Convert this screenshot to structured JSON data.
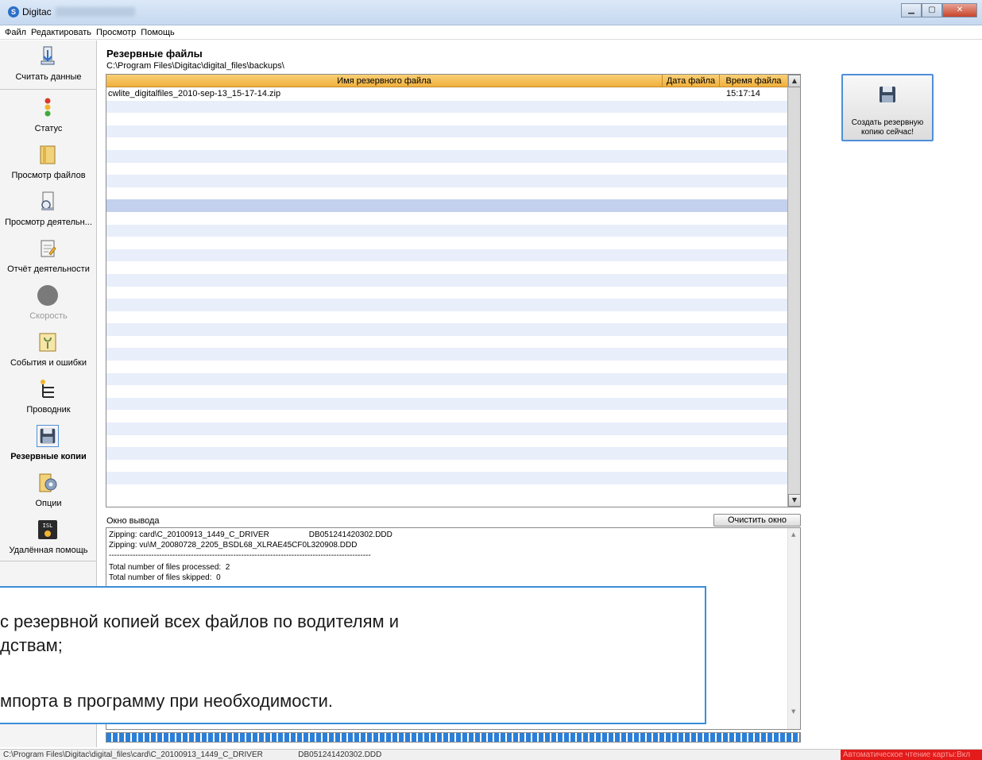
{
  "window": {
    "title": "Digitac",
    "app_icon": "S"
  },
  "menu": [
    "Файл",
    "Редактировать",
    "Просмотр",
    "Помощь"
  ],
  "sidebar": {
    "items": [
      {
        "id": "read-data",
        "label": "Считать данные",
        "icon": "download-icon",
        "disabled": false,
        "active": false
      },
      {
        "id": "status",
        "label": "Статус",
        "icon": "traffic-light-icon",
        "disabled": false,
        "active": false
      },
      {
        "id": "view-files",
        "label": "Просмотр файлов",
        "icon": "folder-icon",
        "disabled": false,
        "active": false
      },
      {
        "id": "view-activity",
        "label": "Просмотр деятельн...",
        "icon": "document-magnifier-icon",
        "disabled": false,
        "active": false
      },
      {
        "id": "activity-report",
        "label": "Отчёт деятельности",
        "icon": "clipboard-icon",
        "disabled": false,
        "active": false
      },
      {
        "id": "speed",
        "label": "Скорость",
        "icon": "speed-circle-icon",
        "disabled": true,
        "active": false
      },
      {
        "id": "events",
        "label": "События и ошибки",
        "icon": "events-icon",
        "disabled": false,
        "active": false
      },
      {
        "id": "explorer",
        "label": "Проводник",
        "icon": "tree-icon",
        "disabled": false,
        "active": false
      },
      {
        "id": "backups",
        "label": "Резервные копии",
        "icon": "floppy-icon",
        "disabled": false,
        "active": true
      },
      {
        "id": "options",
        "label": "Опции",
        "icon": "gear-folder-icon",
        "disabled": false,
        "active": false
      },
      {
        "id": "remote-help",
        "label": "Удалённая помощь",
        "icon": "isl-icon",
        "disabled": false,
        "active": false
      }
    ]
  },
  "backups": {
    "title": "Резервные файлы",
    "path": "C:\\Program Files\\Digitac\\digital_files\\backups\\",
    "columns": [
      "Имя резервного файла",
      "Дата файла",
      "Время файла"
    ],
    "rows": [
      {
        "name": "cwlite_digitalfiles_2010-sep-13_15-17-14.zip",
        "date": "",
        "time": "15:17:14"
      }
    ],
    "create_button": "Создать резервную копию сейчас!"
  },
  "output": {
    "label": "Окно вывода",
    "clear_button": "Очистить окно",
    "lines": [
      "Zipping: card\\C_20100913_1449_C_DRIVER                  DB051241420302.DDD",
      "Zipping: vu\\M_20080728_2205_BSDL68_XLRAE45CF0L320908.DDD",
      "---------------------------------------------------------------------------------------------------",
      "Total number of files processed:  2",
      "Total number of files skipped:  0"
    ]
  },
  "status_bar": {
    "path": "C:\\Program Files\\Digitac\\digital_files\\card\\C_20100913_1449_C_DRIVER                DB051241420302.DDD",
    "indicator": "Автоматическое чтение карты:Вкл"
  },
  "callout": {
    "lines": [
      "с резервной копией всех файлов по водителям и",
      "дствам;",
      "мпорта в программу при необходимости."
    ]
  },
  "progress": {
    "value": 1.0
  },
  "colors": {
    "header": "#f0b03d",
    "accent": "#2b7fd8",
    "status_red": "#e31b1b"
  }
}
